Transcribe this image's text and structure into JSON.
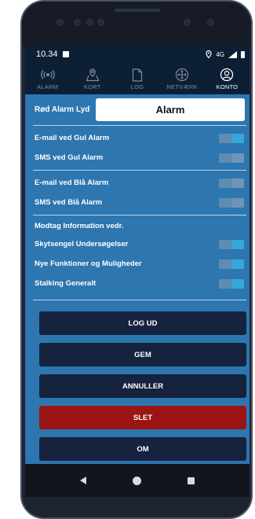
{
  "statusbar": {
    "time": "10.34",
    "network": "4G"
  },
  "tabs": [
    {
      "label": "ALARM",
      "icon": "alarm-signal-icon",
      "active": false
    },
    {
      "label": "KORT",
      "icon": "map-pin-icon",
      "active": false
    },
    {
      "label": "LOG",
      "icon": "document-icon",
      "active": false
    },
    {
      "label": "NETVÆRK",
      "icon": "network-icon",
      "active": false
    },
    {
      "label": "KONTO",
      "icon": "account-icon",
      "active": true
    }
  ],
  "alarm_sound": {
    "label": "Rød Alarm Lyd",
    "value": "Alarm"
  },
  "settings": {
    "email_yellow": {
      "label": "E-mail ved Gul Alarm",
      "on": true
    },
    "sms_yellow": {
      "label": "SMS ved Gul Alarm",
      "on": false
    },
    "email_blue": {
      "label": "E-mail ved Blå Alarm",
      "on": false
    },
    "sms_blue": {
      "label": "SMS ved Blå Alarm",
      "on": false
    },
    "info_heading": "Modtag Information vedr.",
    "skytsengel": {
      "label": "Skytsengel Undersøgelser",
      "on": true
    },
    "new_features": {
      "label": "Nye Funktioner og Muligheder",
      "on": true
    },
    "stalking": {
      "label": "Stalking Generalt",
      "on": true
    }
  },
  "buttons": {
    "logout": "LOG UD",
    "save": "GEM",
    "cancel": "ANNULLER",
    "delete": "SLET",
    "about": "OM"
  },
  "colors": {
    "panel": "#2d76b0",
    "toggle_on": "#35a7e0",
    "button": "#16233f",
    "danger": "#9b1515"
  }
}
